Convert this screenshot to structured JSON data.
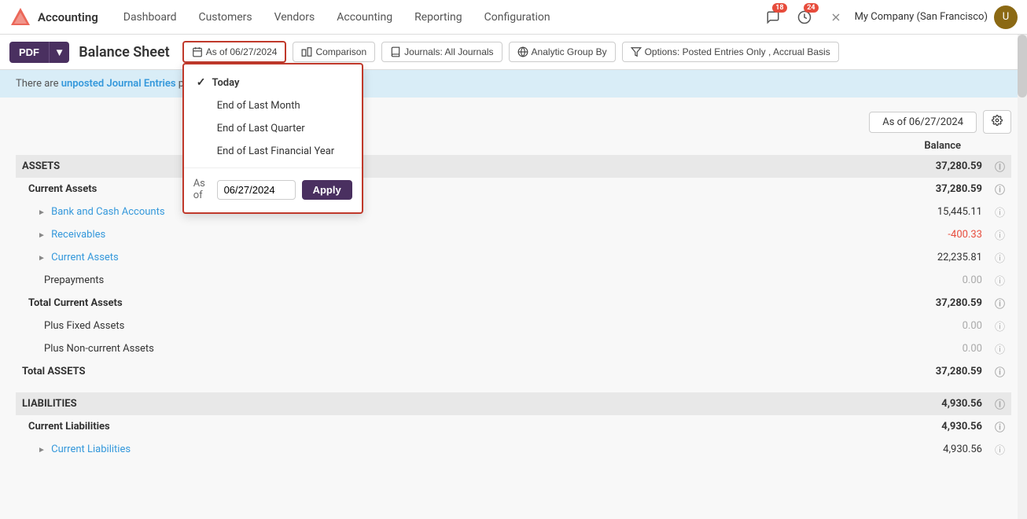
{
  "topnav": {
    "app_name": "Accounting",
    "items": [
      "Dashboard",
      "Customers",
      "Vendors",
      "Accounting",
      "Reporting",
      "Configuration"
    ],
    "badge_messages": "18",
    "badge_activity": "24",
    "company": "My Company (San Francisco)"
  },
  "toolbar": {
    "pdf_label": "PDF",
    "page_title": "Balance Sheet",
    "date_filter_label": "As of 06/27/2024",
    "comparison_label": "Comparison",
    "journals_label": "Journals: All Journals",
    "analytic_label": "Analytic Group By",
    "options_label": "Options: Posted Entries Only , Accrual Basis"
  },
  "date_dropdown": {
    "options": [
      {
        "label": "Today",
        "selected": true
      },
      {
        "label": "End of Last Month",
        "selected": false
      },
      {
        "label": "End of Last Quarter",
        "selected": false
      },
      {
        "label": "End of Last Financial Year",
        "selected": false
      }
    ],
    "as_of_label": "As of",
    "as_of_value": "06/27/2024",
    "apply_label": "Apply"
  },
  "notification": {
    "text_before": "There are ",
    "link_text": "unposted Journal Entries",
    "text_after": " prior or included in this period."
  },
  "report": {
    "header_date": "As of 06/27/2024",
    "balance_label": "Balance",
    "sections": [
      {
        "name": "ASSETS",
        "value": "37,280.59",
        "rows": [
          {
            "type": "group",
            "label": "Current Assets",
            "value": "37,280.59",
            "indent": 1
          },
          {
            "type": "expandable",
            "label": "Bank and Cash Accounts",
            "value": "15,445.11",
            "indent": 2,
            "link": true
          },
          {
            "type": "expandable",
            "label": "Receivables",
            "value": "-400.33",
            "indent": 2,
            "link": true,
            "negative": true
          },
          {
            "type": "expandable",
            "label": "Current Assets",
            "value": "22,235.81",
            "indent": 2,
            "link": true
          },
          {
            "type": "leaf",
            "label": "Prepayments",
            "value": "0.00",
            "indent": 2,
            "muted": true
          },
          {
            "type": "total",
            "label": "Total Current Assets",
            "value": "37,280.59",
            "indent": 1
          },
          {
            "type": "leaf",
            "label": "Plus Fixed Assets",
            "value": "0.00",
            "indent": 2,
            "muted": true
          },
          {
            "type": "leaf",
            "label": "Plus Non-current Assets",
            "value": "0.00",
            "indent": 2,
            "muted": true
          },
          {
            "type": "total",
            "label": "Total ASSETS",
            "value": "37,280.59",
            "indent": 0
          }
        ]
      },
      {
        "name": "LIABILITIES",
        "value": "4,930.56",
        "rows": [
          {
            "type": "group",
            "label": "Current Liabilities",
            "value": "4,930.56",
            "indent": 1
          },
          {
            "type": "expandable",
            "label": "Current Liabilities",
            "value": "4,930.56",
            "indent": 2,
            "link": true
          }
        ]
      }
    ]
  }
}
